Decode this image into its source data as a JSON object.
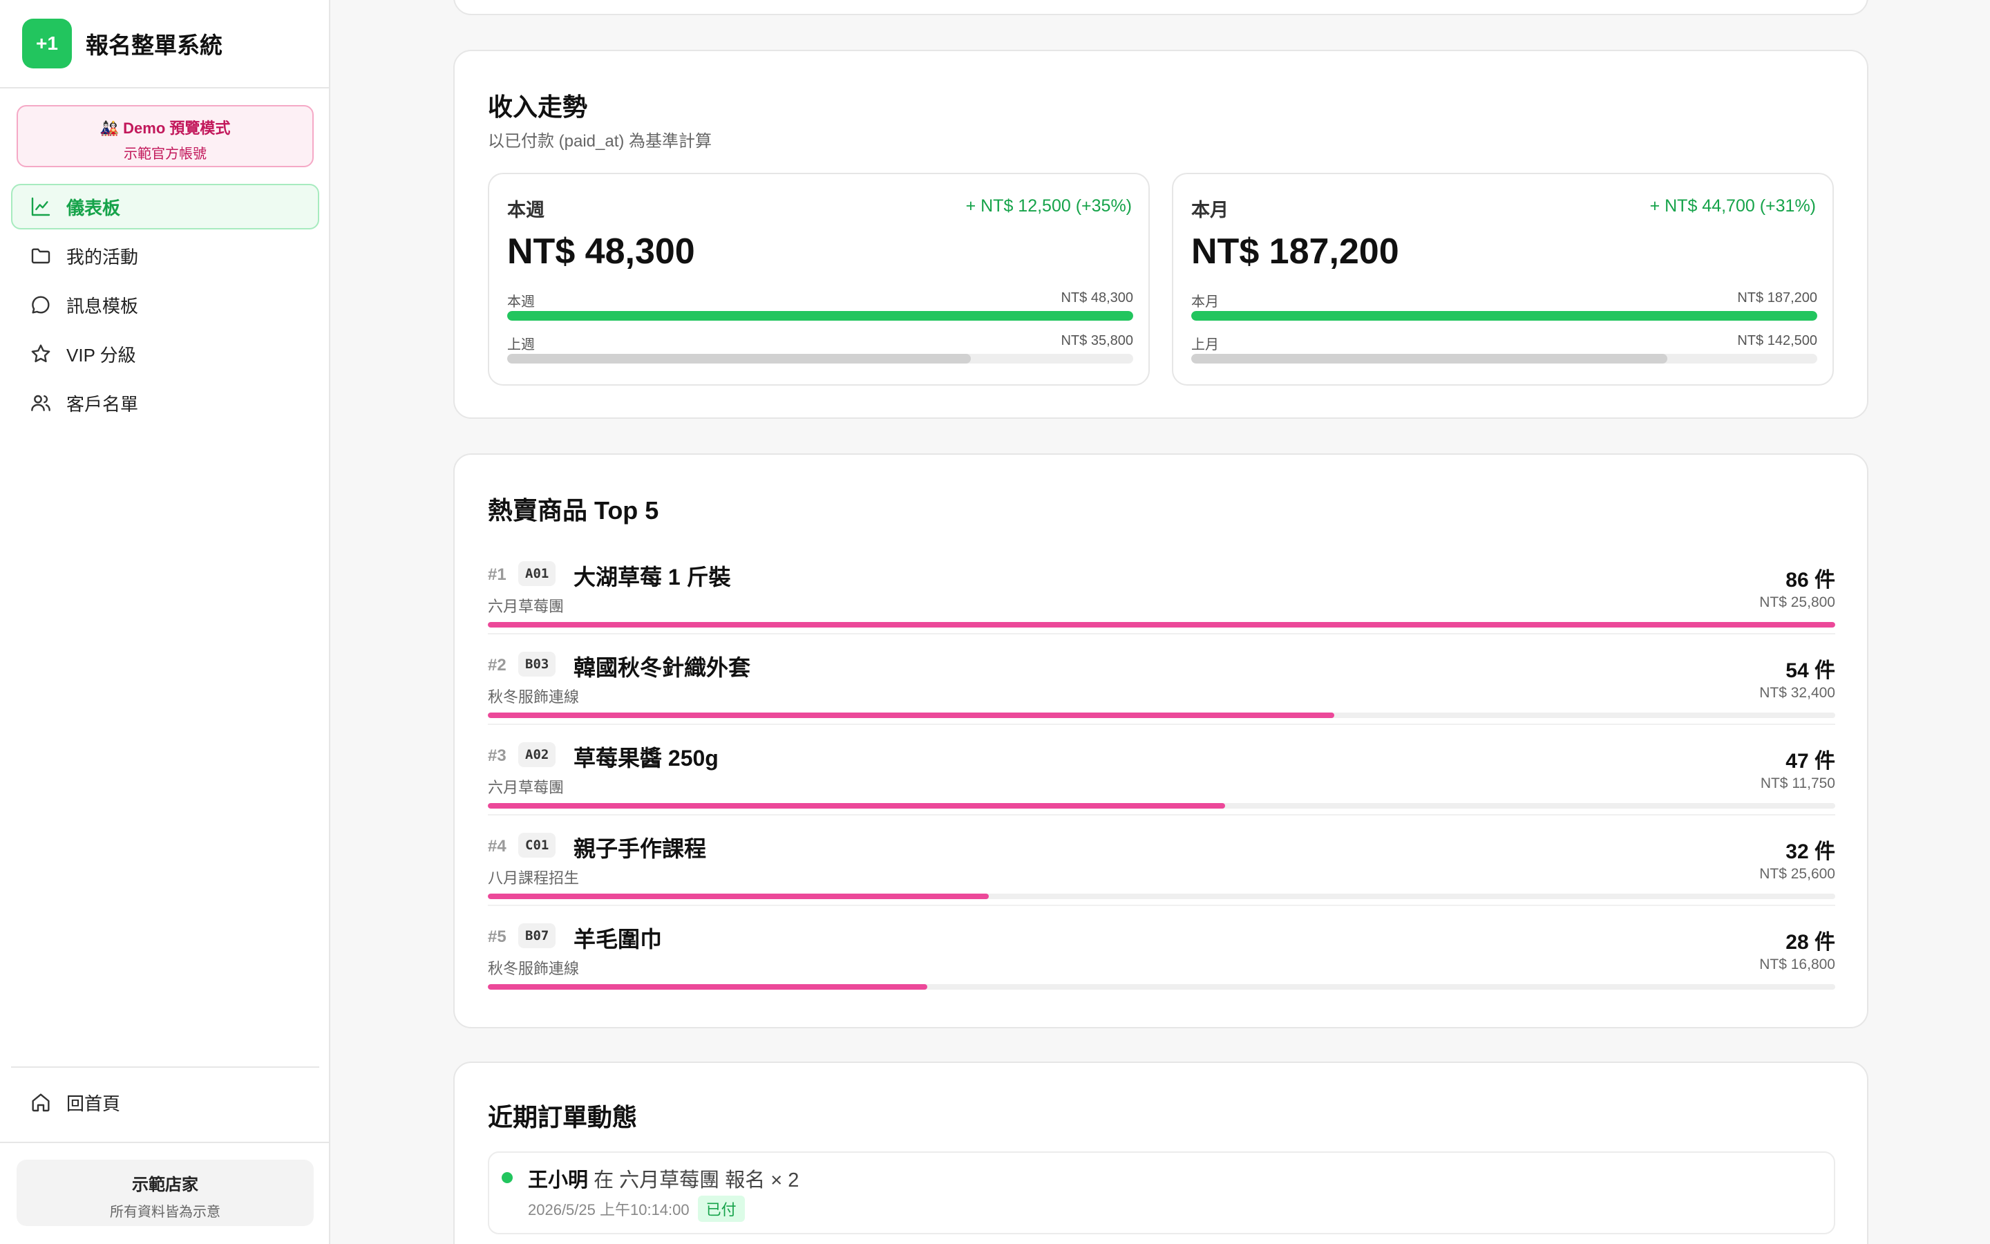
{
  "app": {
    "logo_text": "+1",
    "name": "報名整單系統"
  },
  "demo": {
    "title": "🎎 Demo 預覽模式",
    "subtitle": "示範官方帳號"
  },
  "nav": [
    {
      "label": "儀表板",
      "icon": "chart-line-icon",
      "active": true
    },
    {
      "label": "我的活動",
      "icon": "folder-icon",
      "active": false
    },
    {
      "label": "訊息模板",
      "icon": "message-bubble-icon",
      "active": false
    },
    {
      "label": "VIP 分級",
      "icon": "star-icon",
      "active": false
    },
    {
      "label": "客戶名單",
      "icon": "users-icon",
      "active": false
    }
  ],
  "home": {
    "label": "回首頁",
    "icon": "home-icon"
  },
  "store": {
    "name": "示範店家",
    "note": "所有資料皆為示意"
  },
  "income": {
    "title": "收入走勢",
    "subtitle": "以已付款 (paid_at) 為基準計算",
    "week": {
      "label": "本週",
      "delta": "+ NT$ 12,500 (+35%)",
      "amount": "NT$ 48,300",
      "current_label": "本週",
      "current_value": "NT$ 48,300",
      "current_fraction": 1.0,
      "previous_label": "上週",
      "previous_value": "NT$ 35,800",
      "previous_fraction": 0.741
    },
    "month": {
      "label": "本月",
      "delta": "+ NT$ 44,700 (+31%)",
      "amount": "NT$ 187,200",
      "current_label": "本月",
      "current_value": "NT$ 187,200",
      "current_fraction": 1.0,
      "previous_label": "上月",
      "previous_value": "NT$ 142,500",
      "previous_fraction": 0.761
    }
  },
  "top5": {
    "title": "熱賣商品 Top 5",
    "items": [
      {
        "rank": "#1",
        "code": "A01",
        "name": "大湖草莓 1 斤裝",
        "group": "六月草莓團",
        "qty": "86 件",
        "revenue": "NT$ 25,800",
        "fraction": 1.0
      },
      {
        "rank": "#2",
        "code": "B03",
        "name": "韓國秋冬針織外套",
        "group": "秋冬服飾連線",
        "qty": "54 件",
        "revenue": "NT$ 32,400",
        "fraction": 0.628
      },
      {
        "rank": "#3",
        "code": "A02",
        "name": "草莓果醬 250g",
        "group": "六月草莓團",
        "qty": "47 件",
        "revenue": "NT$ 11,750",
        "fraction": 0.547
      },
      {
        "rank": "#4",
        "code": "C01",
        "name": "親子手作課程",
        "group": "八月課程招生",
        "qty": "32 件",
        "revenue": "NT$ 25,600",
        "fraction": 0.372
      },
      {
        "rank": "#5",
        "code": "B07",
        "name": "羊毛圍巾",
        "group": "秋冬服飾連線",
        "qty": "28 件",
        "revenue": "NT$ 16,800",
        "fraction": 0.326
      }
    ]
  },
  "orders": {
    "title": "近期訂單動態",
    "items": [
      {
        "customer": "王小明",
        "at": "在",
        "event": "六月草莓團",
        "action": "報名 × 2",
        "time": "2026/5/25 上午10:14:00",
        "status": "已付"
      }
    ]
  },
  "colors": {
    "brand": "#22c55e",
    "accent_pink": "#ec4899",
    "demo_pink": "#c2185b"
  }
}
